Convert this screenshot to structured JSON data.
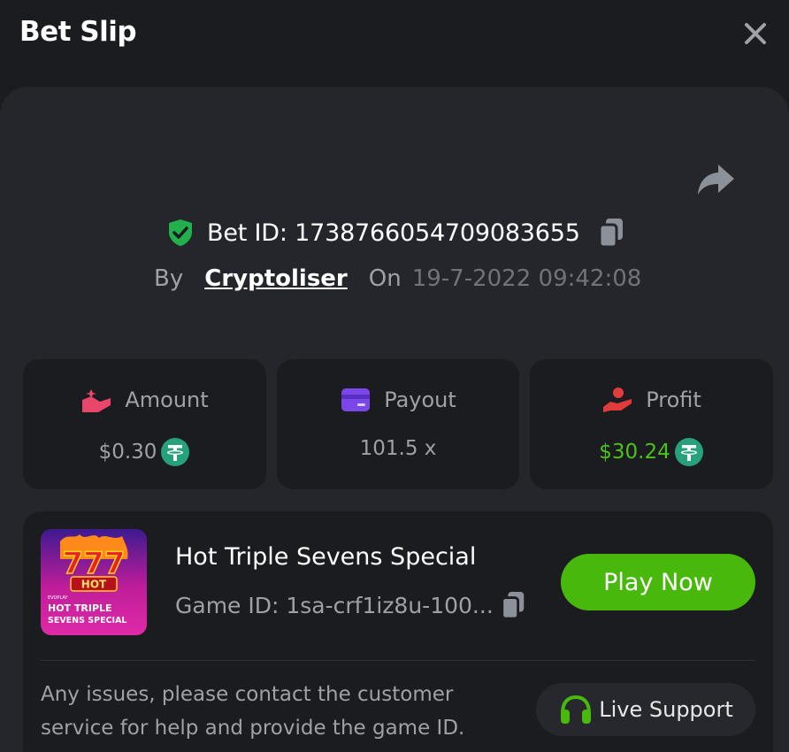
{
  "header": {
    "title": "Bet Slip"
  },
  "bet": {
    "id_text": "Bet ID: 1738766054709083655",
    "by_label": "By",
    "username": "Cryptoliser",
    "on_label": "On",
    "datetime": "19-7-2022 09:42:08"
  },
  "stats": {
    "amount": {
      "label": "Amount",
      "value": "$0.30"
    },
    "payout": {
      "label": "Payout",
      "value": "101.5 x"
    },
    "profit": {
      "label": "Profit",
      "value": "$30.24"
    }
  },
  "game": {
    "name": "Hot Triple Sevens Special",
    "id_text": "Game ID: 1sa-crf1iz8u-100...",
    "play_label": "Play Now",
    "thumb": {
      "sevens": "777",
      "badge": "HOT",
      "brand": "EVOPLAY",
      "title_line1": "HOT TRIPLE",
      "title_line2": "SEVENS SPECIAL"
    }
  },
  "support": {
    "help_text": "Any issues, please contact the customer service for help and provide the game ID.",
    "button_label": "Live Support"
  },
  "colors": {
    "accent_green": "#48b80c",
    "profit_green": "#4cc21c",
    "tether": "#26a17b",
    "shield": "#21b04b",
    "payout_purple": "#7b47e8",
    "amount_pink": "#e8466a",
    "profit_red": "#e23b3b"
  },
  "icons": [
    "close-icon",
    "share-icon",
    "shield-check-icon",
    "copy-icon",
    "amount-icon",
    "payout-icon",
    "profit-icon",
    "tether-icon",
    "headset-icon"
  ]
}
